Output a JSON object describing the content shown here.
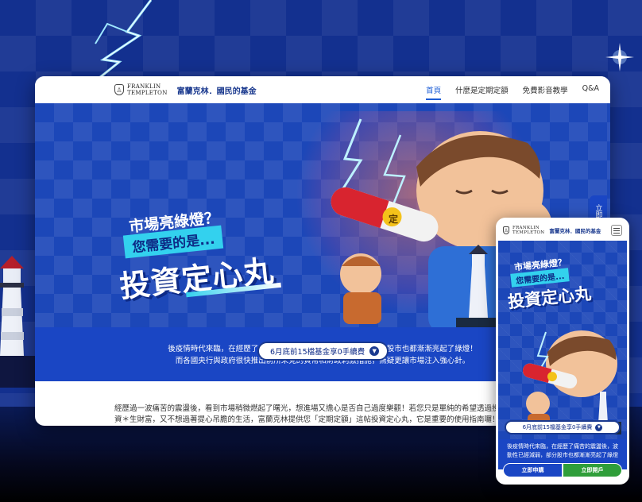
{
  "desktop": {
    "logo": {
      "line1": "FRANKLIN",
      "line2": "TEMPLETON"
    },
    "brand_cn": "富蘭克林．國民的基金",
    "nav": [
      {
        "label": "首頁",
        "active": true
      },
      {
        "label": "什麼是定期定額",
        "active": false
      },
      {
        "label": "免費影音教學",
        "active": false
      },
      {
        "label": "Q&A",
        "active": false
      }
    ],
    "hero": {
      "question": "市場亮綠燈？",
      "subtitle": "您需要的是...",
      "main": "投資定心丸",
      "pill_char": "定",
      "promo": "6月底前15檔基金享0手續費",
      "band_line1": "後疫情時代來臨，在經歷了痛苦的震盪後，波動性已經減弱，部分股市也都漸漸亮起了綠燈！",
      "band_line2": "而各國央行與政府很快推出前所未見的貨幣和財政刺激措施，無疑更讓市場注入強心針。"
    },
    "intro_line1": "經歷過一波痛苦的震盪後，看到市場稍微燃起了曙光，想進場又擔心是否自己過度樂觀！若您只是單純的希望透過投",
    "intro_line2": "資＊生財富，又不想過著提心吊膽的生活，富蘭克林提供您「定期定額」這帖投資定心丸，它是重要的使用指南囉！",
    "side_tab": "立即"
  },
  "mobile": {
    "logo": {
      "line1": "FRANKLIN",
      "line2": "TEMPLETON"
    },
    "brand_cn": "富蘭克林．國民的基金",
    "question": "市場亮綠燈？",
    "subtitle": "您需要的是...",
    "main": "投資定心丸",
    "promo": "6月底前15檔基金享0手續費",
    "band_line1": "後疫情時代來臨，在經歷了痛苦的震盪後，波",
    "band_line2": "動性已經減弱，部分股市也都漸漸亮起了綠燈",
    "btn_apply": "立即申購",
    "btn_open": "立即開戶"
  },
  "colors": {
    "brand_blue": "#1a46c4",
    "accent_cyan": "#33d1ee",
    "cta_green": "#2f9e3a",
    "pill_red": "#d8242f"
  }
}
